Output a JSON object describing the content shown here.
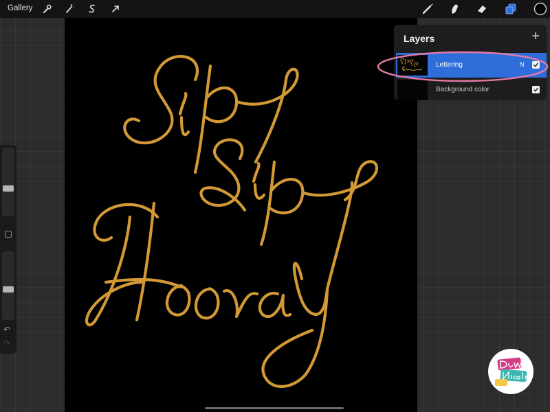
{
  "topbar": {
    "gallery_label": "Gallery",
    "left_tools": [
      "wrench-icon",
      "magic-wand-icon",
      "selection-icon",
      "transform-arrow-icon"
    ],
    "right_tools": [
      "brush-icon",
      "smudge-icon",
      "eraser-icon",
      "layers-icon",
      "color-swatch"
    ]
  },
  "colors": {
    "accent_blue": "#2f6ddb",
    "lettering_gold": "#e2a53a",
    "highlight_pink": "#e27aa8",
    "canvas_bg": "#000000",
    "ui_bg": "#2c2c2c"
  },
  "layers_panel": {
    "title": "Layers",
    "add_icon": "+",
    "layers": [
      {
        "name": "Lettering",
        "blend_mode": "N",
        "visible": true,
        "selected": true
      },
      {
        "name": "Background color",
        "visible": true,
        "selected": false
      }
    ]
  },
  "canvas": {
    "artwork_text": [
      "Sip",
      "Sip",
      "Hooray"
    ],
    "artwork_style": "gold brush script lettering on black"
  },
  "sidebar": {
    "brush_size_level": 0.38,
    "opacity_level": 0.39
  },
  "watermark": {
    "text": "Dawn Nicole"
  }
}
